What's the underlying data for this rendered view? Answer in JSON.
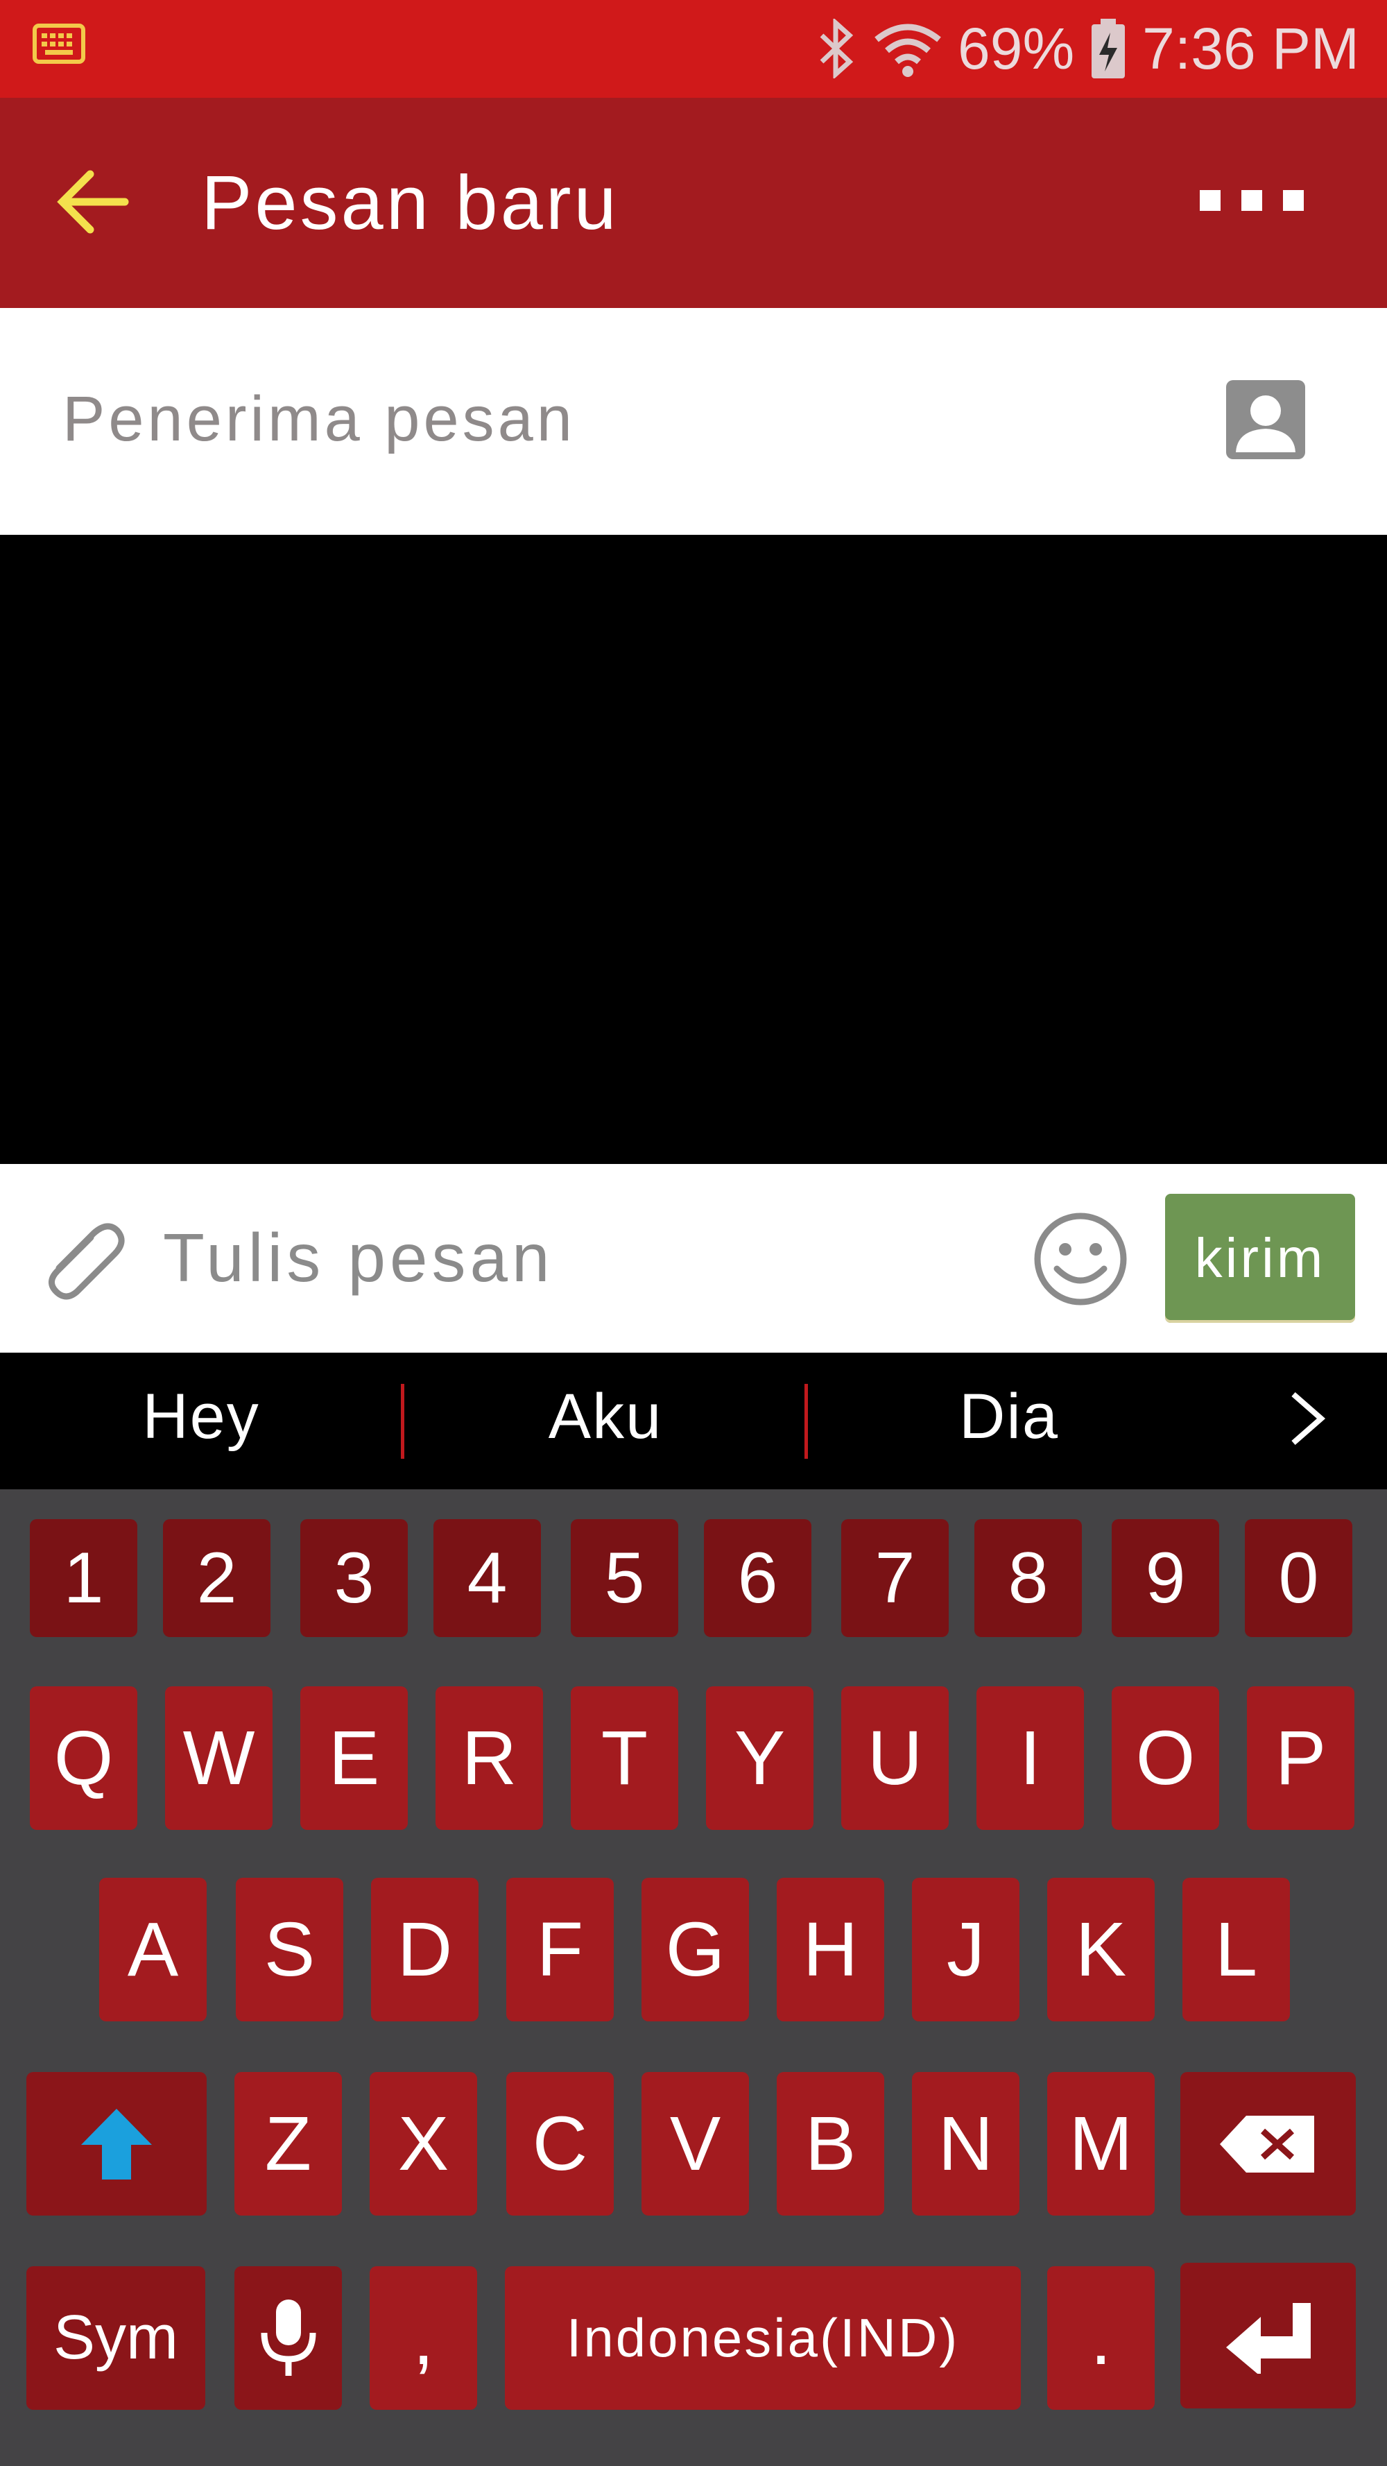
{
  "status_bar": {
    "battery": "69%",
    "time": "7:36 PM",
    "icons": [
      "keyboard-icon",
      "bluetooth-icon",
      "wifi-icon",
      "battery-charging-icon"
    ]
  },
  "app_bar": {
    "title": "Pesan baru",
    "back_icon": "arrow-left-icon",
    "menu_icon": "overflow-menu-icon"
  },
  "recipient": {
    "placeholder": "Penerima pesan",
    "value": "",
    "contact_icon": "contact-person-icon"
  },
  "compose": {
    "placeholder": "Tulis pesan",
    "value": "",
    "attach_icon": "paperclip-icon",
    "emoji_icon": "smiley-icon",
    "send_label": "kirim"
  },
  "suggestions": {
    "items": [
      "Hey",
      "Aku",
      "Dia"
    ],
    "more_icon": "chevron-right-icon"
  },
  "keyboard": {
    "numbers": [
      "1",
      "2",
      "3",
      "4",
      "5",
      "6",
      "7",
      "8",
      "9",
      "0"
    ],
    "row1": [
      "Q",
      "W",
      "E",
      "R",
      "T",
      "Y",
      "U",
      "I",
      "O",
      "P"
    ],
    "row2": [
      "A",
      "S",
      "D",
      "F",
      "G",
      "H",
      "J",
      "K",
      "L"
    ],
    "row3": [
      "Z",
      "X",
      "C",
      "V",
      "B",
      "N",
      "M"
    ],
    "sym_label": "Sym",
    "comma": ",",
    "space_label": "Indonesia(IND)",
    "period": ".",
    "shift_icon": "shift-arrow-icon",
    "backspace_icon": "backspace-icon",
    "mic_icon": "microphone-icon",
    "enter_icon": "enter-icon"
  },
  "colors": {
    "status_bar": "#d0191a",
    "app_bar": "#a31b1f",
    "key": "#a31b1f",
    "number_key": "#7a1215",
    "send_button": "#6e9653",
    "back_arrow": "#f4e04d",
    "shift_arrow": "#1ba0dd",
    "keyboard_bg": "#444345"
  }
}
